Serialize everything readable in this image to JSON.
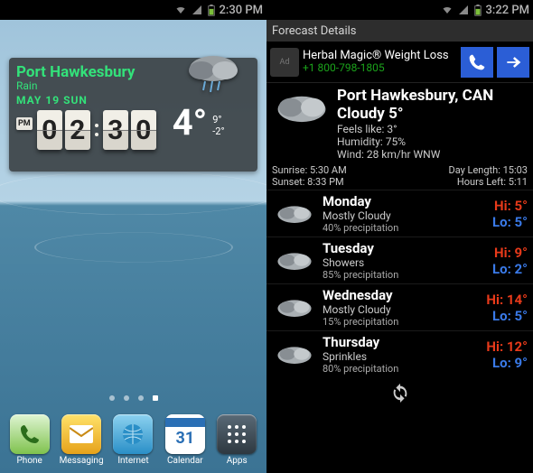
{
  "left": {
    "status_time": "2:30 PM",
    "widget": {
      "location": "Port Hawkesbury",
      "condition": "Rain",
      "date": "MAY 19  SUN",
      "ampm": "PM",
      "h1": "0",
      "h2": "2",
      "m1": "3",
      "m2": "0",
      "temp": "4°",
      "hi": "9°",
      "lo": "-2°"
    },
    "dock": [
      {
        "label": "Phone"
      },
      {
        "label": "Messaging"
      },
      {
        "label": "Internet"
      },
      {
        "label": "Calendar"
      },
      {
        "label": "Apps"
      }
    ]
  },
  "right": {
    "status_time": "3:22 PM",
    "header": "Forecast Details",
    "ad": {
      "title": "Herbal Magic® Weight Loss",
      "phone": "+1 800-798-1805"
    },
    "current": {
      "location": "Port Hawkesbury, CAN",
      "summary": "Cloudy 5°",
      "feels": "Feels like: 3°",
      "humidity": "Humidity: 75%",
      "wind": "Wind: 28 km/hr WNW"
    },
    "sun": {
      "sunrise": "Sunrise: 5:30 AM",
      "sunset": "Sunset: 8:33 PM",
      "daylen": "Day Length: 15:03",
      "hoursleft": "Hours Left: 5:11"
    },
    "days": [
      {
        "name": "Monday",
        "cond": "Mostly Cloudy",
        "prec": "40% precipitation",
        "hi": "Hi: 5°",
        "lo": "Lo: 5°"
      },
      {
        "name": "Tuesday",
        "cond": "Showers",
        "prec": "85% precipitation",
        "hi": "Hi: 9°",
        "lo": "Lo: 2°"
      },
      {
        "name": "Wednesday",
        "cond": "Mostly Cloudy",
        "prec": "15% precipitation",
        "hi": "Hi: 14°",
        "lo": "Lo: 5°"
      },
      {
        "name": "Thursday",
        "cond": "Sprinkles",
        "prec": "80% precipitation",
        "hi": "Hi: 12°",
        "lo": "Lo: 9°"
      }
    ]
  }
}
